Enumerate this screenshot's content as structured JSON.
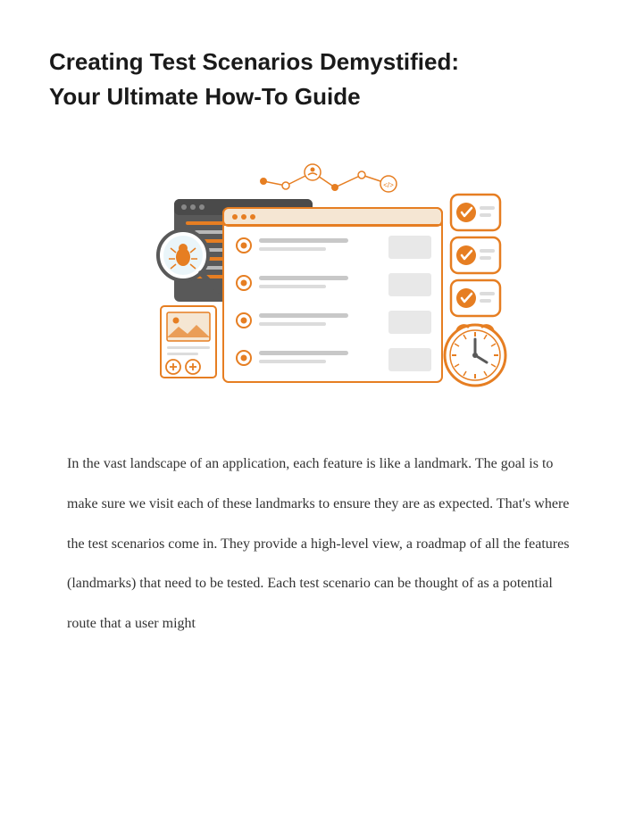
{
  "title_line1": "Creating Test Scenarios Demystified:",
  "title_line2": "Your Ultimate How-To Guide",
  "body": "In the vast landscape of an application, each feature is like a landmark. The goal is to make sure we visit each of these landmarks to ensure they are as expected. That's where the test scenarios come in. They provide a high-level view, a roadmap of all the features (landmarks) that need to be tested. Each test scenario can be thought of as a potential route that a user might",
  "colors": {
    "orange": "#e67e22",
    "orangeBright": "#f08c1c",
    "lightGray": "#dcdcdc",
    "mediumGray": "#b8b8b8",
    "darkGray": "#595959",
    "white": "#ffffff"
  }
}
